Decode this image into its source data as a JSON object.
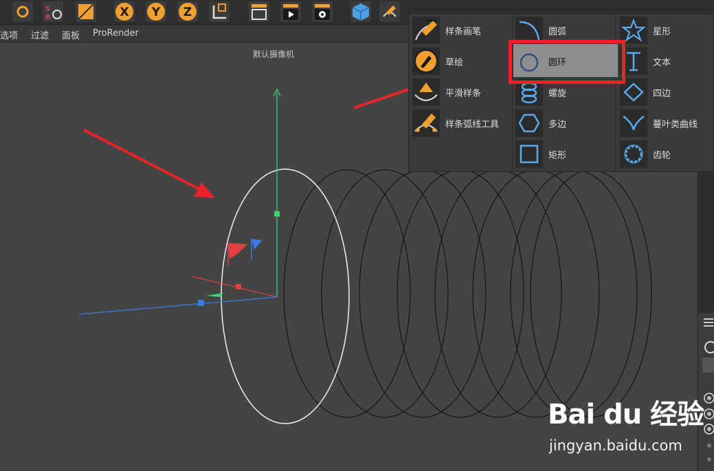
{
  "menubar": {
    "items": [
      "选项",
      "过滤",
      "面板",
      "ProRender"
    ]
  },
  "viewport": {
    "camera_label": "默认摄像机"
  },
  "spline_menu": {
    "col1": [
      "样条画笔",
      "草绘",
      "平滑样条",
      "样条弧线工具"
    ],
    "col2": [
      "圆弧",
      "圆环",
      "螺旋",
      "多边",
      "矩形"
    ],
    "col3": [
      "星形",
      "文本",
      "四边",
      "蔓叶类曲线",
      "齿轮"
    ],
    "selected": "圆环"
  },
  "colors": {
    "accent_orange": "#f0a030",
    "highlight_red": "#e8232a",
    "axis_x": "#e04040",
    "axis_y": "#3cd070",
    "axis_z": "#3a7ae0"
  },
  "toolbar": {
    "axis_buttons": [
      "X",
      "Y",
      "Z"
    ],
    "letters_srt": [
      "S",
      "R"
    ]
  },
  "icons": {
    "tool": [
      "undo-redo-icon",
      "srt-icon",
      "object-icon",
      "x-axis-icon",
      "y-axis-icon",
      "z-axis-icon",
      "coordinate-icon",
      "render-region-icon",
      "render-view-icon",
      "render-settings-icon",
      "cube-icon",
      "pen-icon"
    ]
  },
  "watermark": {
    "brand": "Bai du 经验",
    "url": "jingyan.baidu.com"
  }
}
